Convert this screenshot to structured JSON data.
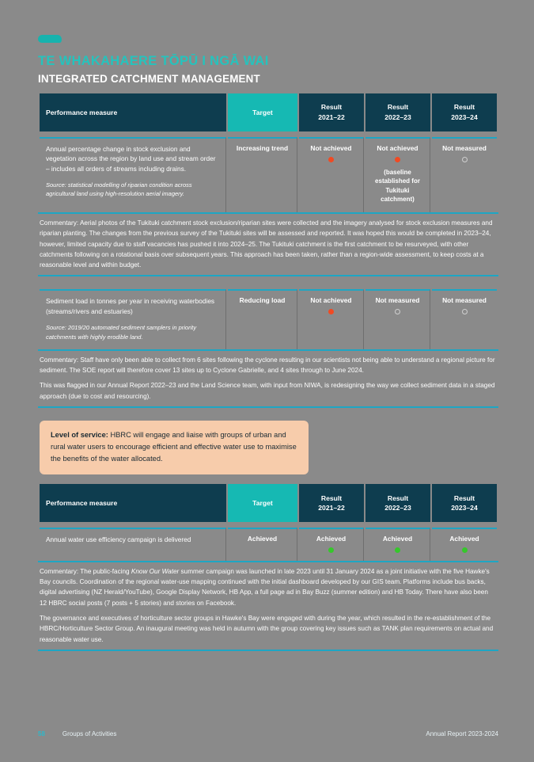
{
  "header": {
    "maori_title": "TE WHAKAHAERE TŌPŪ I NGĀ WAI",
    "english_title": "INTEGRATED CATCHMENT MANAGEMENT",
    "logo": "hbrc-logo-mark"
  },
  "table_headers": {
    "measure": "Performance measure",
    "target": "Target",
    "result_1_line1": "Result",
    "result_1_line2": "2021–22",
    "result_2_line1": "Result",
    "result_2_line2": "2022–23",
    "result_3_line1": "Result",
    "result_3_line2": "2023–24"
  },
  "table_one": {
    "rows": [
      {
        "measure": "Annual percentage change in stock exclusion and vegetation across the region by land use and stream order – includes all orders of streams including drains.",
        "source": "Source: statistical modelling of riparian condition across agricultural land using high-resolution aerial imagery.",
        "target": "Increasing trend",
        "result_2021_22": "Not achieved",
        "result_2021_22_status": "red",
        "result_2022_23": "Not achieved",
        "result_2022_23_status": "red",
        "result_2022_23_note": "(baseline established for Tukituki catchment)",
        "result_2023_24": "Not measured",
        "result_2023_24_status": "grey",
        "commentary": [
          "Commentary: Aerial photos of the Tukituki catchment stock exclusion/riparian sites were collected and the imagery analysed for stock exclusion measures and riparian planting. The changes from the previous survey of the Tukituki sites will be assessed and reported. It was hoped this would be completed in 2023–24, however, limited capacity due to staff vacancies has pushed it into 2024–25. The Tukituki catchment is the first catchment to be resurveyed, with other catchments following on a rotational basis over subsequent years. This approach has been taken, rather than a region-wide assessment, to keep costs at a reasonable level and within budget."
        ]
      },
      {
        "measure": "Sediment load in tonnes per year in receiving waterbodies (streams/rivers and estuaries)",
        "source": "Source: 2019/20 automated sediment samplers in priority catchments with highly erodible land.",
        "target": "Reducing load",
        "result_2021_22": "Not achieved",
        "result_2021_22_status": "red",
        "result_2022_23": "Not measured",
        "result_2022_23_status": "grey",
        "result_2022_23_note": "",
        "result_2023_24": "Not measured",
        "result_2023_24_status": "grey",
        "commentary": [
          "Commentary: Staff have only been able to collect from 6 sites following the cyclone resulting in our scientists not being able to understand a regional picture for sediment. The SOE report will therefore cover 13 sites up to Cyclone Gabrielle, and 4 sites through to June 2024.",
          "This was flagged in our Annual Report 2022–23 and the Land Science team, with input from NIWA, is redesigning the way we collect sediment data in a staged approach (due to cost and resourcing)."
        ]
      }
    ]
  },
  "level_of_service": {
    "label": "Level of service:",
    "text": " HBRC will engage and liaise with groups of urban and rural water users to encourage efficient and effective water use to maximise the benefits of the water allocated."
  },
  "table_two": {
    "rows": [
      {
        "measure": "Annual water use efficiency campaign is delivered",
        "target": "Achieved",
        "result_2021_22": "Achieved",
        "result_2021_22_status": "green",
        "result_2022_23": "Achieved",
        "result_2022_23_status": "green",
        "result_2023_24": "Achieved",
        "result_2023_24_status": "green",
        "commentary_pre": "Commentary: The public-facing ",
        "commentary_italic": "Know Our Water",
        "commentary_post": " summer campaign was launched in late 2023 until 31 January 2024 as a joint initiative with the five Hawke's Bay councils. Coordination of the regional water-use mapping continued with the initial dashboard developed by our GIS team. Platforms include bus backs, digital advertising (NZ Herald/YouTube), Google Display Network, HB App, a full page ad in Bay Buzz (summer edition) and HB Today. There have also been 12 HBRC social posts (7 posts + 5 stories) and stories on Facebook.",
        "commentary_second": "The governance and executives of horticulture sector groups in Hawke's Bay were engaged with during the year, which resulted in the re-establishment of the HBRC/Horticulture Sector Group. An inaugural meeting was held in autumn with the group covering key issues such as TANK plan requirements on actual and reasonable water use."
      }
    ]
  },
  "footer": {
    "page_number": "58",
    "section": "Groups of Activities",
    "report": "Annual Report 2023-2024"
  }
}
